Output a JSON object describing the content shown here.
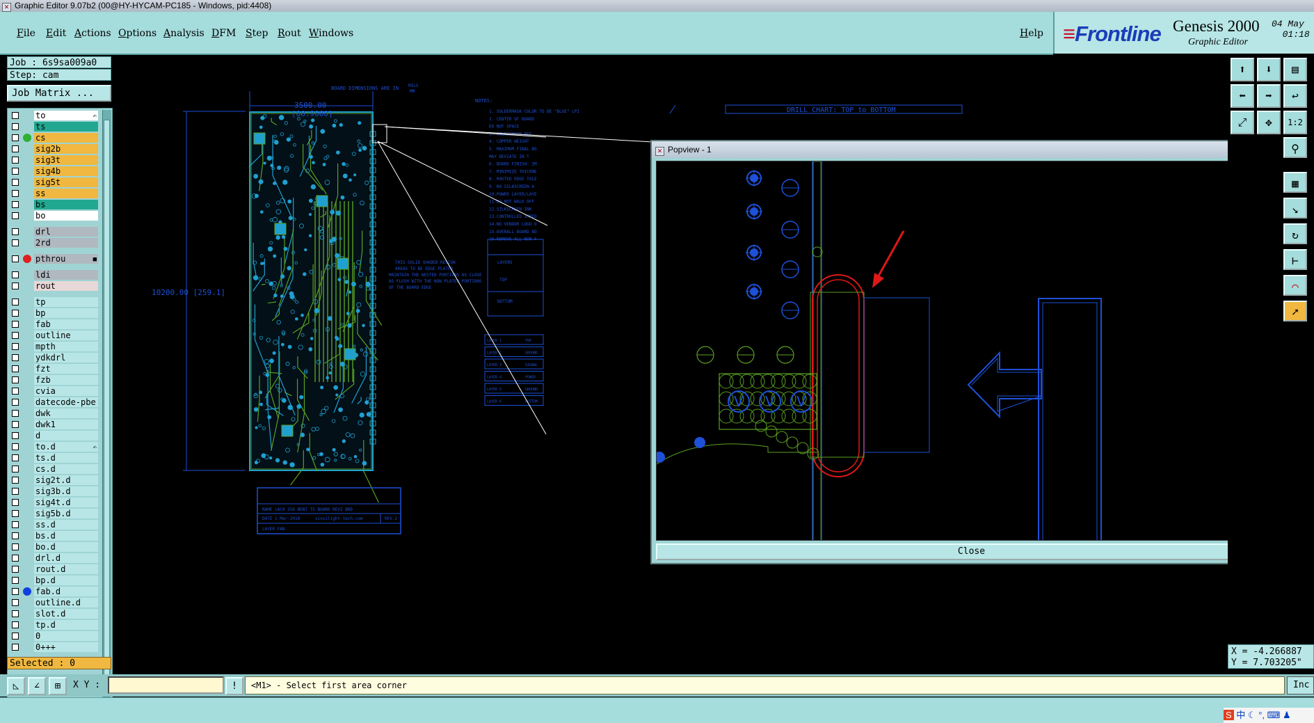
{
  "window": {
    "title": "Graphic Editor 9.07b2 (00@HY-HYCAM-PC185 - Windows, pid:4408)"
  },
  "menu": [
    "File",
    "Edit",
    "Actions",
    "Options",
    "Analysis",
    "DFM",
    "Step",
    "Rout",
    "Windows"
  ],
  "help_label": "Help",
  "brand": {
    "logo": "Frontline",
    "product": "Genesis 2000",
    "subtitle": "Graphic Editor",
    "date": "04 May",
    "time": "01:18"
  },
  "job": {
    "job_label": "Job : 6s9sa009a0",
    "step_label": "Step: cam",
    "matrix_button": "Job Matrix ..."
  },
  "layers_group1": [
    {
      "name": "to",
      "bg": "#ffffff",
      "dot": "",
      "mark": "✍"
    },
    {
      "name": "ts",
      "bg": "#22a890",
      "dot": "",
      "mark": ""
    },
    {
      "name": "cs",
      "bg": "#f0b840",
      "dot": "#30b030",
      "mark": ""
    },
    {
      "name": "sig2b",
      "bg": "#f0b840",
      "dot": "",
      "mark": ""
    },
    {
      "name": "sig3t",
      "bg": "#f0b840",
      "dot": "",
      "mark": ""
    },
    {
      "name": "sig4b",
      "bg": "#f0b840",
      "dot": "",
      "mark": ""
    },
    {
      "name": "sig5t",
      "bg": "#f0b840",
      "dot": "",
      "mark": ""
    },
    {
      "name": "ss",
      "bg": "#f0b840",
      "dot": "",
      "mark": ""
    },
    {
      "name": "bs",
      "bg": "#22a890",
      "dot": "",
      "mark": ""
    },
    {
      "name": "bo",
      "bg": "#ffffff",
      "dot": "",
      "mark": ""
    }
  ],
  "layers_group2": [
    {
      "name": "drl",
      "bg": "#b0b8c0",
      "dot": "",
      "mark": ""
    },
    {
      "name": "2rd",
      "bg": "#b0b8c0",
      "dot": "",
      "mark": ""
    }
  ],
  "layers_group3": [
    {
      "name": "pthrou",
      "bg": "#b0b8c0",
      "dot": "#e02020",
      "mark": "■"
    }
  ],
  "layers_group4": [
    {
      "name": "ldi",
      "bg": "#b0b8c0",
      "dot": "",
      "mark": ""
    },
    {
      "name": "rout",
      "bg": "#e8d8d8",
      "dot": "",
      "mark": ""
    }
  ],
  "layers_group5": [
    {
      "name": "tp",
      "bg": "#b8e6e6",
      "dot": "",
      "mark": ""
    },
    {
      "name": "bp",
      "bg": "#b8e6e6",
      "dot": "",
      "mark": ""
    },
    {
      "name": "fab",
      "bg": "#b8e6e6",
      "dot": "",
      "mark": ""
    },
    {
      "name": "outline",
      "bg": "#b8e6e6",
      "dot": "",
      "mark": ""
    },
    {
      "name": "mpth",
      "bg": "#b8e6e6",
      "dot": "",
      "mark": ""
    },
    {
      "name": "ydkdrl",
      "bg": "#b8e6e6",
      "dot": "",
      "mark": ""
    },
    {
      "name": "fzt",
      "bg": "#b8e6e6",
      "dot": "",
      "mark": ""
    },
    {
      "name": "fzb",
      "bg": "#b8e6e6",
      "dot": "",
      "mark": ""
    },
    {
      "name": "cvia",
      "bg": "#b8e6e6",
      "dot": "",
      "mark": ""
    },
    {
      "name": "datecode-pbe",
      "bg": "#b8e6e6",
      "dot": "",
      "mark": ""
    },
    {
      "name": "dwk",
      "bg": "#b8e6e6",
      "dot": "",
      "mark": ""
    },
    {
      "name": "dwk1",
      "bg": "#b8e6e6",
      "dot": "",
      "mark": ""
    },
    {
      "name": "d",
      "bg": "#b8e6e6",
      "dot": "",
      "mark": ""
    },
    {
      "name": "to.d",
      "bg": "#b8e6e6",
      "dot": "",
      "mark": "✍"
    },
    {
      "name": "ts.d",
      "bg": "#b8e6e6",
      "dot": "",
      "mark": ""
    },
    {
      "name": "cs.d",
      "bg": "#b8e6e6",
      "dot": "",
      "mark": ""
    },
    {
      "name": "sig2t.d",
      "bg": "#b8e6e6",
      "dot": "",
      "mark": ""
    },
    {
      "name": "sig3b.d",
      "bg": "#b8e6e6",
      "dot": "",
      "mark": ""
    },
    {
      "name": "sig4t.d",
      "bg": "#b8e6e6",
      "dot": "",
      "mark": ""
    },
    {
      "name": "sig5b.d",
      "bg": "#b8e6e6",
      "dot": "",
      "mark": ""
    },
    {
      "name": "ss.d",
      "bg": "#b8e6e6",
      "dot": "",
      "mark": ""
    },
    {
      "name": "bs.d",
      "bg": "#b8e6e6",
      "dot": "",
      "mark": ""
    },
    {
      "name": "bo.d",
      "bg": "#b8e6e6",
      "dot": "",
      "mark": ""
    },
    {
      "name": "drl.d",
      "bg": "#b8e6e6",
      "dot": "",
      "mark": ""
    },
    {
      "name": "rout.d",
      "bg": "#b8e6e6",
      "dot": "",
      "mark": ""
    },
    {
      "name": "bp.d",
      "bg": "#b8e6e6",
      "dot": "",
      "mark": ""
    },
    {
      "name": "fab.d",
      "bg": "#b8e6e6",
      "dot": "#1040e0",
      "mark": ""
    },
    {
      "name": "outline.d",
      "bg": "#b8e6e6",
      "dot": "",
      "mark": ""
    },
    {
      "name": "slot.d",
      "bg": "#b8e6e6",
      "dot": "",
      "mark": ""
    },
    {
      "name": "tp.d",
      "bg": "#b8e6e6",
      "dot": "",
      "mark": ""
    },
    {
      "name": "0",
      "bg": "#b8e6e6",
      "dot": "",
      "mark": ""
    },
    {
      "name": "0+++",
      "bg": "#b8e6e6",
      "dot": "",
      "mark": ""
    }
  ],
  "selected_label": "Selected : 0",
  "coords": {
    "x": "X = -4.266887",
    "y": "Y = 7.703205\""
  },
  "bottom": {
    "xy_label": "X Y :",
    "xy_value": "",
    "prompt": "<M1> - Select first area corner",
    "inc_label": "Inc"
  },
  "popup": {
    "title": "Popview - 1",
    "close_label": "Close"
  },
  "drawing": {
    "board_dims": "BOARD DIMENSIONS ARE IN",
    "mils": "MILS",
    "mm": "MM",
    "width_dim": "3500.00",
    "width_mm": "[88.9000]",
    "height_dim": "10200.00 [259.1]",
    "notes_title": "NOTES:",
    "notes": [
      "1. SOLDERMASK COLOR TO BE \"BLUE\" LPI",
      "2. CENTER OF BOARD",
      "   DO NOT SPACE",
      "3. SILKSCREEN REF",
      "4. COPPER WEIGHT",
      "5. MAXIMUM FINAL BO",
      "   MAY DEVIATE IN T",
      "6. BOARD FINISH: IM",
      "7. MINIMIZE THICKNE",
      "8. ROUTED EDGE TOLE",
      "9. NO SILKSCREEN A",
      "10.POWER LAYER/LAYE",
      "11.DO NOT WALK OFF",
      "12.SILKSCREEN INK",
      "13.CONTROLLED IMPED",
      "14.NO VENDOR LOGO O",
      "15.OVERALL BOARD BO",
      "16.REMOVE ALL NON F"
    ],
    "hatch_note": [
      "THIS SOLID SHADED REGION",
      "AREAS TO BE EDGE PLATED",
      "MAINTAIN THE NESTED PORTIONS AS CLOSE",
      "AS FLUSH WITH THE NON PLATED PORTIONS",
      "OF THE BOARD EDGE"
    ],
    "drill_chart": "DRILL CHART: TOP to BOTTOM",
    "layers_table": {
      "header": "LAYERS",
      "rows": [
        "TOP",
        "BOTTOM"
      ]
    },
    "stack_rows": [
      "LAYER 1",
      "LAYER 2",
      "LAYER 3",
      "LAYER 4",
      "LAYER 5",
      "LAYER 6"
    ],
    "stack_vals": [
      "TOP",
      "GROUND",
      "SIGNAL",
      "POWER",
      "GROUND",
      "BOTTOM"
    ],
    "title_block": {
      "name": "NAME cACH 256 BENT TG BOARD REV2 BRD",
      "date": "DATE 1 Mar-2018",
      "company": "xinxilight-tech.com",
      "rev": "REV.2",
      "layer": "LAYER FAB"
    }
  },
  "colors": {
    "accent_teal": "#a5dcdc",
    "drawing_blue": "#1e50d8",
    "trace_green": "#5aa020",
    "pad_cyan": "#20a0d0",
    "red_marker": "#e01818"
  },
  "icons": [
    "window-icon",
    "frontline-logo",
    "layer-checkbox",
    "edit-pencil-icon",
    "zoom-icon",
    "arrow-up-icon",
    "arrow-down-icon",
    "pan-icon",
    "red-arrow-annotation"
  ]
}
